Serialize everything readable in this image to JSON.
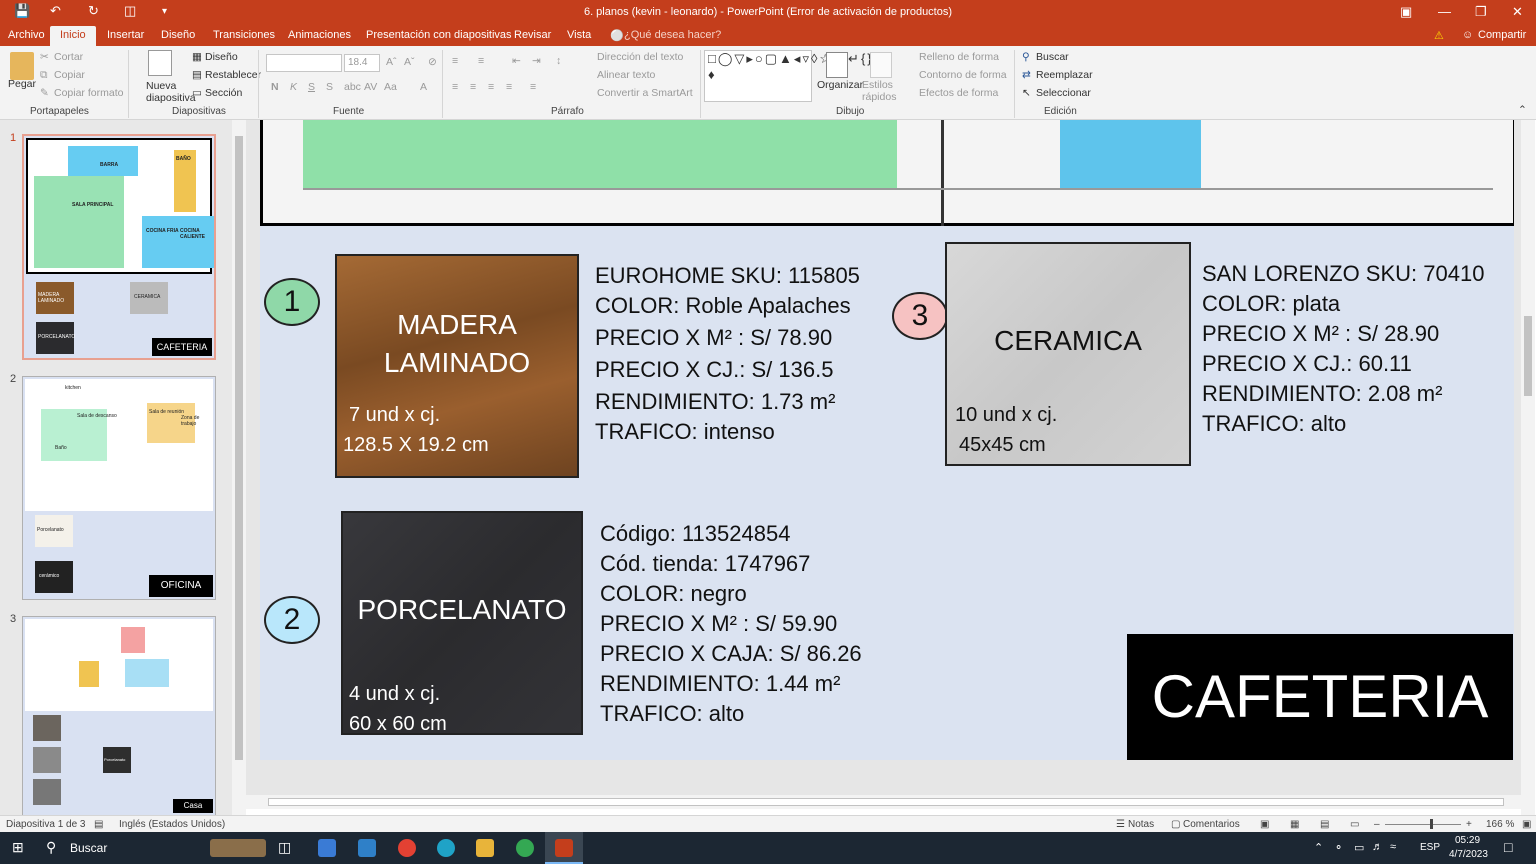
{
  "window": {
    "title": "6. planos (kevin - leonardo) - PowerPoint (Error de activación de productos)"
  },
  "tabs": [
    "Archivo",
    "Inicio",
    "Insertar",
    "Diseño",
    "Transiciones",
    "Animaciones",
    "Presentación con diapositivas",
    "Revisar",
    "Vista"
  ],
  "tell_me": "¿Qué desea hacer?",
  "share": "Compartir",
  "ribbon": {
    "paste": "Pegar",
    "cut": "Cortar",
    "copy": "Copiar",
    "format_painter": "Copiar formato",
    "new_slide": "Nueva diapositiva",
    "layout": "Diseño",
    "reset": "Restablecer",
    "section": "Sección",
    "font_name": "",
    "font_size": "18.4",
    "text_direction": "Dirección del texto",
    "align_text": "Alinear texto",
    "smartart": "Convertir a SmartArt",
    "arrange": "Organizar",
    "quick_styles": "Estilos rápidos",
    "shape_fill": "Relleno de forma",
    "shape_outline": "Contorno de forma",
    "shape_effects": "Efectos de forma",
    "find": "Buscar",
    "replace": "Reemplazar",
    "select": "Seleccionar",
    "groups": [
      "Portapapeles",
      "Diapositivas",
      "Fuente",
      "Párrafo",
      "Dibujo",
      "Edición"
    ]
  },
  "thumbnails": [
    {
      "num": "1",
      "badge": "CAFETERIA",
      "labels": [
        "BARRA",
        "BAÑO",
        "SALA PRINCIPAL",
        "COCINA FRIA",
        "COCINA CALIENTE",
        "MADERA LAMINADO",
        "CERAMICA",
        "PORCELANATO"
      ]
    },
    {
      "num": "2",
      "badge": "OFICINA",
      "labels": [
        "kitchen",
        "Sala de descanso",
        "Sala de reunión",
        "Zona de trabajo",
        "Baño",
        "Porcelanato",
        "cerámico"
      ]
    },
    {
      "num": "3",
      "badge": "Casa",
      "labels": [
        "Porcelanato"
      ]
    }
  ],
  "slide": {
    "items": [
      {
        "num": "1",
        "color": "#8fd8a8",
        "tile": "MADERA\nLAMINADO",
        "sub1": "7 und x cj.",
        "sub2": "128.5 X 19.2 cm",
        "lines": [
          "EUROHOME SKU: 115805",
          "COLOR: Roble Apalaches",
          "PRECIO X M² : S/ 78.90",
          "PRECIO X CJ.: S/ 136.5",
          "RENDIMIENTO: 1.73 m²",
          "TRAFICO: intenso"
        ]
      },
      {
        "num": "2",
        "color": "#b9e7fb",
        "tile": "PORCELANATO",
        "sub1": "4 und x cj.",
        "sub2": "60 x 60 cm",
        "lines": [
          "Código: 113524854",
          "Cód. tienda: 1747967",
          "COLOR: negro",
          "PRECIO X M² : S/ 59.90",
          "PRECIO X CAJA: S/ 86.26",
          "RENDIMIENTO: 1.44 m²",
          "TRAFICO: alto"
        ]
      },
      {
        "num": "3",
        "color": "#f6c2c2",
        "tile": "CERAMICA",
        "sub1": "10 und x cj.",
        "sub2": "45x45 cm",
        "lines": [
          "SAN LORENZO SKU: 70410",
          "COLOR: plata",
          "PRECIO X M² : S/ 28.90",
          "PRECIO X CJ.: 60.11",
          "RENDIMIENTO: 2.08 m²",
          "TRAFICO: alto"
        ]
      }
    ],
    "banner": "CAFETERIA"
  },
  "status": {
    "slide": "Diapositiva 1 de 3",
    "lang": "Inglés (Estados Unidos)",
    "notes": "Notas",
    "comments": "Comentarios",
    "zoom": "166 %"
  },
  "taskbar": {
    "search": "Buscar",
    "time": "05:29",
    "date": "4/7/2023",
    "lang": "ESP"
  }
}
